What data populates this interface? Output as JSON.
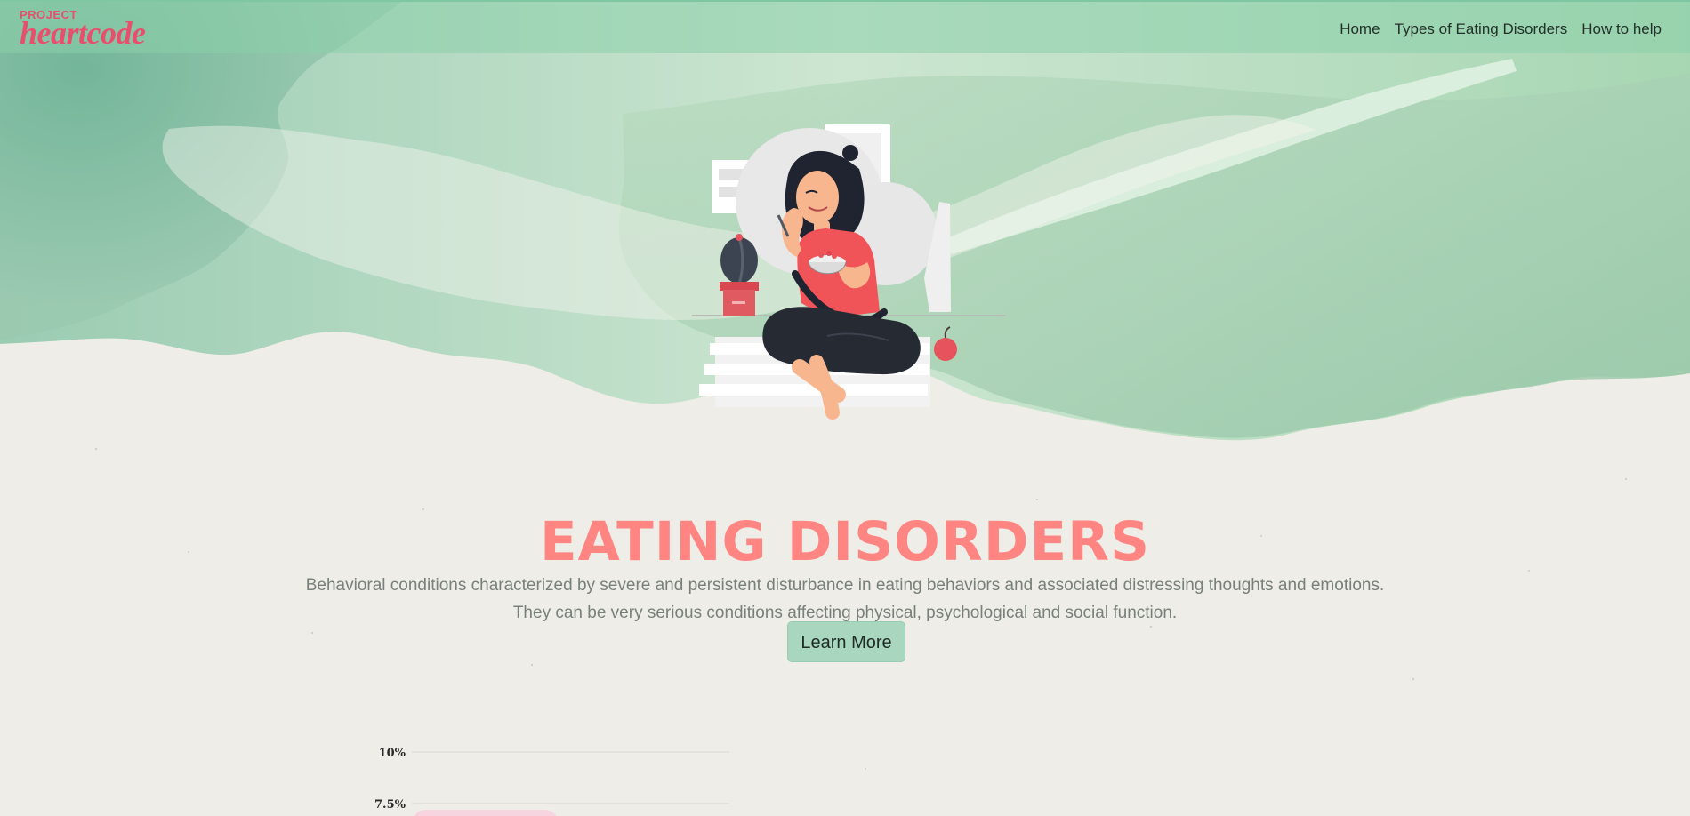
{
  "app": {
    "logo": {
      "small": "PROJECT",
      "big": "heartcode"
    }
  },
  "nav": {
    "items": [
      {
        "label": "Home"
      },
      {
        "label": "Types of Eating Disorders"
      },
      {
        "label": "How to help"
      }
    ]
  },
  "hero": {
    "title": "EATING DISORDERS",
    "description": [
      "Behavioral conditions characterized by severe and persistent disturbance in eating behaviors and associated distressing thoughts and emotions.",
      "They can be very serious conditions affecting physical, psychological and social function."
    ],
    "cta_label": "Learn More",
    "illustration_icon": "woman-eating-bowl-illustration"
  },
  "colors": {
    "brand": "#e84f6d",
    "title": "#ff8582",
    "navbar": "#8acfaa",
    "button": "#a9d6be",
    "chart_bar": "#f6d4e0"
  },
  "chart_data": {
    "type": "bar",
    "y_ticks": [
      "10%",
      "7.5%"
    ],
    "categories": [
      ""
    ],
    "values": [
      7.2
    ],
    "ylim_visible": [
      7.5,
      10
    ],
    "grid": true
  }
}
